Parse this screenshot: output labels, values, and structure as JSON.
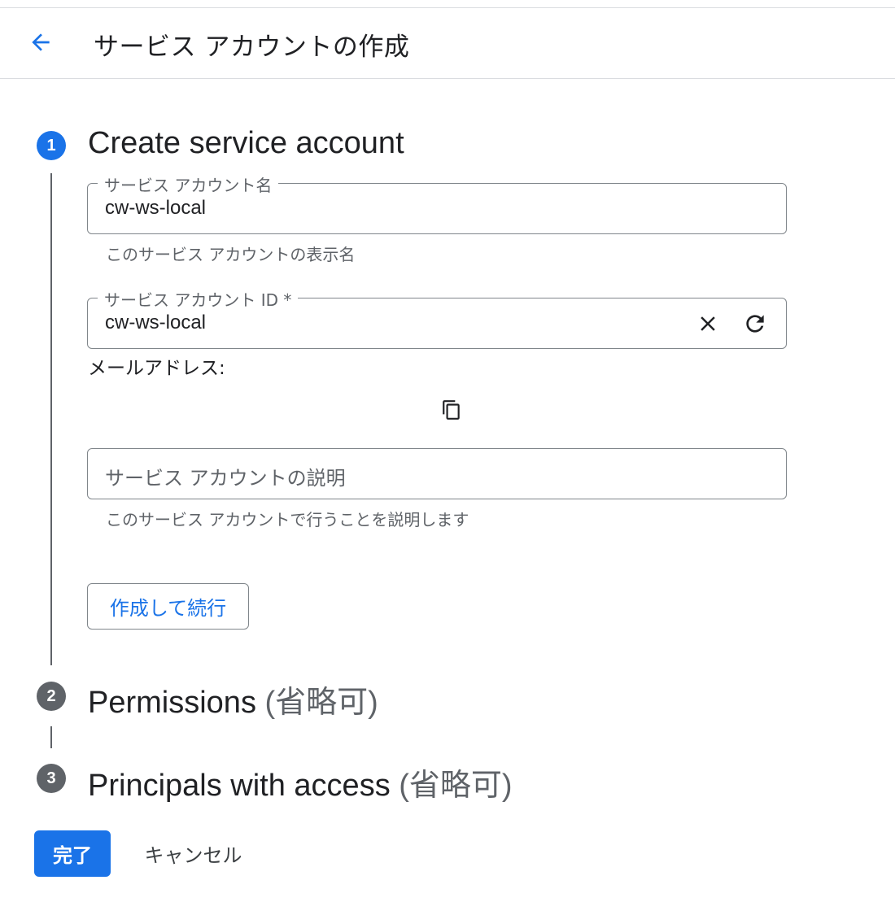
{
  "header": {
    "title": "サービス アカウントの作成",
    "back_icon": "arrow-back-icon"
  },
  "steps": [
    {
      "number": "1",
      "title": "Create service account",
      "optional": ""
    },
    {
      "number": "2",
      "title": "Permissions ",
      "optional": "(省略可)"
    },
    {
      "number": "3",
      "title": "Principals with access ",
      "optional": "(省略可)"
    }
  ],
  "form": {
    "name": {
      "label": "サービス アカウント名",
      "value": "cw-ws-local",
      "hint": "このサービス アカウントの表示名"
    },
    "id": {
      "label": "サービス アカウント ID *",
      "value": "cw-ws-local",
      "clear_icon": "close-icon",
      "refresh_icon": "refresh-icon"
    },
    "email": {
      "label": "メールアドレス:",
      "copy_icon": "copy-icon"
    },
    "description": {
      "placeholder": "サービス アカウントの説明",
      "hint": "このサービス アカウントで行うことを説明します"
    },
    "create_continue_label": "作成して続行"
  },
  "footer": {
    "done_label": "完了",
    "cancel_label": "キャンセル"
  },
  "colors": {
    "accent": "#1a73e8",
    "inactive_step": "#5f6368",
    "border": "#80868b",
    "divider": "#dadce0"
  }
}
